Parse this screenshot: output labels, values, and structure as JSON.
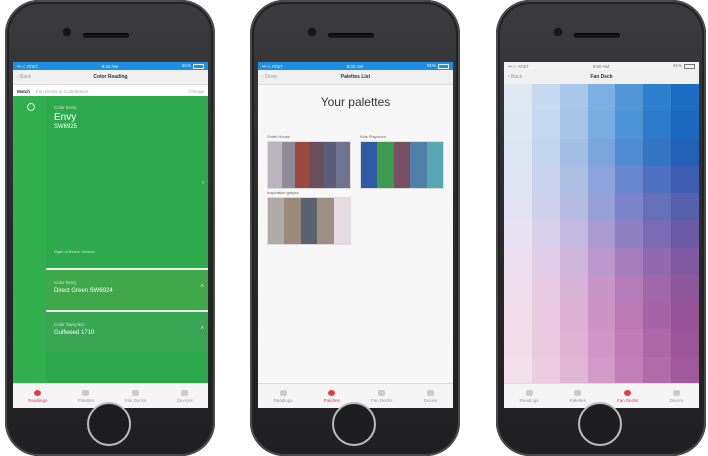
{
  "screens": [
    {
      "status": {
        "carrier": "••○○ AT&T",
        "time": "8:43 AM",
        "battery": "91%"
      },
      "nav": {
        "back": "‹ Back",
        "title": "Color Reading"
      },
      "match": {
        "label": "Match",
        "placeholder": "Fan Decks or Contributors",
        "change": "Change"
      },
      "main_color": {
        "label": "Color Entry",
        "name": "Envy",
        "code": "SW6925"
      },
      "light_note": "Night of Beach Greens",
      "alternatives": [
        {
          "label": "Color Entry",
          "name": "Direct Green SW6924"
        },
        {
          "label": "Color Sampled",
          "name": "Gulfweed 1710"
        }
      ],
      "tabs": [
        "Readings",
        "Palettes",
        "Fan Decks",
        "Devices"
      ],
      "active_tab": 0
    },
    {
      "status": {
        "carrier": "••○○ AT&T",
        "time": "9:33 AM",
        "battery": "91%"
      },
      "nav": {
        "back": "‹ Done",
        "title": "Palettes List"
      },
      "heading": "Your palettes",
      "palettes": [
        {
          "name": "Smith House",
          "colors": [
            "#b9b4bd",
            "#8f8a99",
            "#9b4a3f",
            "#6a4e5c",
            "#5b5d78",
            "#6f7390"
          ]
        },
        {
          "name": "Kids Playroom",
          "colors": [
            "#2f5aa4",
            "#3c9b4c",
            "#7a4f64",
            "#4e7fa6",
            "#57a7b4"
          ]
        },
        {
          "name": "Inspiration grayes",
          "colors": [
            "#b2aaa8",
            "#9c8a7a",
            "#5a6270",
            "#9e8f85",
            "#e8dbe4"
          ]
        }
      ],
      "tabs": [
        "Readings",
        "Palettes",
        "Fan Decks",
        "Device"
      ],
      "active_tab": 1
    },
    {
      "status": {
        "carrier": "••○○ AT&T",
        "time": "9:50 AM",
        "battery": "91%"
      },
      "nav": {
        "back": "‹ Back",
        "title": "Fan Deck"
      },
      "fan_rows": [
        [
          "#dfe9f4",
          "#c7daf0",
          "#a9c7ea",
          "#7fb0e4",
          "#5296d8",
          "#2f7fcf",
          "#1c6cc4"
        ],
        [
          "#dde8f3",
          "#c4d8ef",
          "#a5c4e8",
          "#7aaddf",
          "#4c92d4",
          "#2c7bcb",
          "#1a67bf"
        ],
        [
          "#dce5f2",
          "#c3d4ed",
          "#a4bfe6",
          "#7aa6dc",
          "#4f8bd0",
          "#3474c4",
          "#245fb6"
        ],
        [
          "#dfe4f2",
          "#c9d2ec",
          "#adbde4",
          "#8aa3da",
          "#6887cc",
          "#4f6fc0",
          "#3f5db0"
        ],
        [
          "#e3e3f3",
          "#cfd1ec",
          "#b6bbe3",
          "#979fd8",
          "#7c84c9",
          "#6670ba",
          "#5460ab"
        ],
        [
          "#e8e2f2",
          "#d8d0ea",
          "#c3b8e0",
          "#a99bd2",
          "#8f80c2",
          "#7b6bb4",
          "#6a5aa6"
        ],
        [
          "#ece0ef",
          "#e0cde6",
          "#d0b5dc",
          "#bb98cd",
          "#a57dbd",
          "#9169ae",
          "#805aa0"
        ],
        [
          "#efdfec",
          "#e6cbe3",
          "#d9b2d8",
          "#c795c8",
          "#b37bb8",
          "#a067a9",
          "#8f579b"
        ],
        [
          "#f1deea",
          "#e9cae0",
          "#ddb1d4",
          "#cd93c4",
          "#ba79b3",
          "#a764a4",
          "#965396"
        ],
        [
          "#f3dfea",
          "#ebcbe0",
          "#e0b3d4",
          "#d196c5",
          "#bf7cb5",
          "#ad67a6",
          "#9b5698"
        ],
        [
          "#f4e1ec",
          "#eccde2",
          "#e2b6d6",
          "#d39ac8",
          "#c280b8",
          "#b06ba9",
          "#9f599b"
        ]
      ],
      "tabs": [
        "Readings",
        "Palettes",
        "Fan Decks",
        "Device"
      ],
      "active_tab": 2
    }
  ]
}
